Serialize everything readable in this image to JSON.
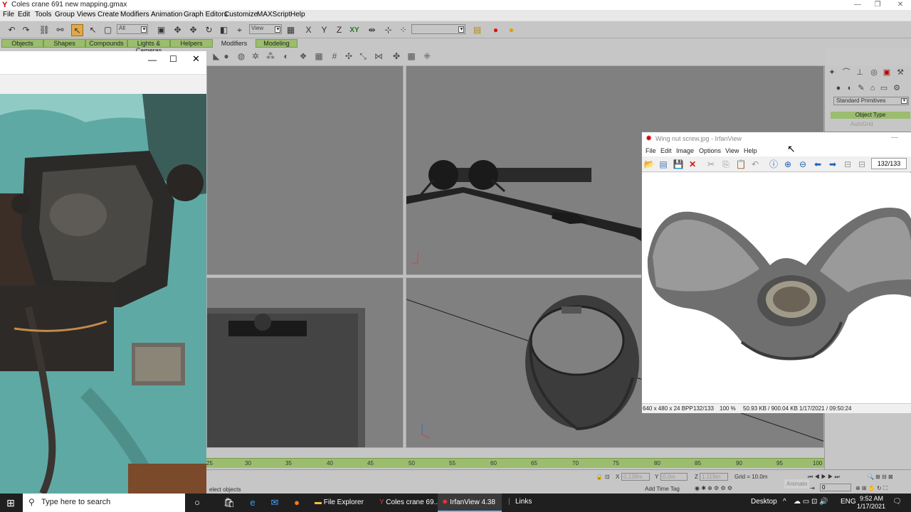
{
  "gmax": {
    "title": "Coles crane 691 new mapping.gmax",
    "menu": [
      "File",
      "Edit",
      "Tools",
      "Group",
      "Views",
      "Create",
      "Modifiers",
      "Animation",
      "Graph Editors",
      "Customize",
      "MAXScript",
      "Help"
    ],
    "selection_filter": "All",
    "ref_coord": "View",
    "tabs": [
      "Objects",
      "Shapes",
      "Compounds",
      "Lights & Cameras",
      "Helpers",
      "Modifiers",
      "Modeling"
    ],
    "active_tab": "Modifiers",
    "command_panel": {
      "dropdown": "Standard Primitives",
      "rollout": "Object Type",
      "autogrid": "AutoGrid"
    },
    "timeline": {
      "ticks": [
        "25",
        "30",
        "35",
        "40",
        "45",
        "50",
        "55",
        "60",
        "65",
        "70",
        "75",
        "80",
        "85",
        "90",
        "95",
        "100"
      ]
    },
    "status": {
      "prompt": "elect objects",
      "x": "0.138m",
      "y": "0.0m",
      "z": "1.119m",
      "grid": "Grid = 10.0m",
      "add_time_tag": "Add Time Tag",
      "animate": "Animate",
      "frame": "0"
    }
  },
  "irfanview": {
    "title": "Wing nut screw.jpg - IrfanView",
    "menu": [
      "File",
      "Edit",
      "Image",
      "Options",
      "View",
      "Help"
    ],
    "counter": "132/133",
    "status": {
      "dims": "640 x 480 x 24 BPP",
      "index": "132/133",
      "zoom": "100 %",
      "size": "50.93 KB / 900.04 KB",
      "date": "1/17/2021 / 09:50:24"
    }
  },
  "taskbar": {
    "search_placeholder": "Type here to search",
    "apps": [
      "File Explorer",
      "Coles crane 69...",
      "IrfanView 4.38"
    ],
    "links": "Links",
    "desktop": "Desktop",
    "lang": "ENG",
    "time": "9:52 AM",
    "date": "1/17/2021"
  }
}
